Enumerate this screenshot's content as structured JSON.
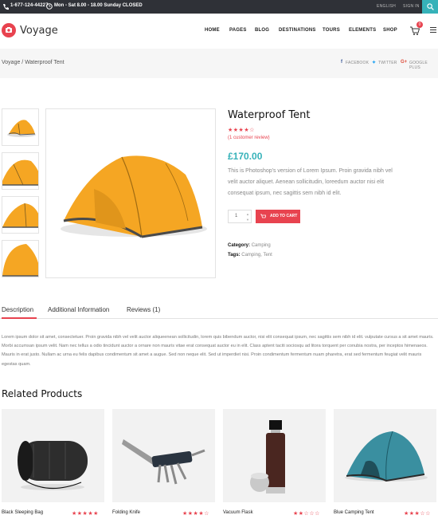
{
  "topbar": {
    "phone": "1-677-124-44227",
    "hours": "Mon - Sat 8.00 - 18.00 Sunday CLOSED",
    "language": "ENGLISH",
    "signin": "SIGN IN",
    "search_icon": "search-icon"
  },
  "header": {
    "logo_text": "Voyage",
    "nav": [
      "HOME",
      "PAGES",
      "BLOG",
      "DESTINATIONS",
      "TOURS",
      "ELEMENTS",
      "SHOP"
    ],
    "cart_count": "0"
  },
  "breadcrumb": {
    "text": "Voyage / Waterproof Tent",
    "share": {
      "facebook": "FACEBOOK",
      "twitter": "TWITTER",
      "google": "GOOGLE PLUS"
    }
  },
  "product": {
    "title": "Waterproof Tent",
    "stars": "★★★★☆",
    "rating": 4,
    "review_link": "(1 customer review)",
    "price": "£170.00",
    "description": "This is Photoshop's version of Lorem Ipsum. Proin gravida nibh vel velit auctor aliquet. Aenean sollicitudin, loreedum auctor nisi elit consequat ipsum, nec sagittis sem nibh id elit.",
    "quantity": "1",
    "add_to_cart": "ADD TO CART",
    "category_label": "Category:",
    "category_value": "Camping",
    "tags_label": "Tags:",
    "tags_value": "Camping, Tent"
  },
  "tabs": [
    "Description",
    "Additional Information",
    "Reviews (1)"
  ],
  "long_description": "Lorem ipsum dolor sit amet, consectetuer. Proin gravida nibh vel velit auctor aliqueenean sollicitudin, lorem quis bibendum auctor, nisi elit consequat ipsum, nec sagittis sem nibh id elit. vulputate cursus a sit amet mauris. Morbi accumsan ipsum velit. Nam nec tellus a odio tincidunt auctor a ornare non mauris vitae erat consequat auctor eu in elit. Class aptent taciti sociosqu ad litora torquent per conubia nostra, per inceptos himenaeos. Mauris in erat justo. Nullam ac urna eu felis dapibus condimentum sit amet a augue. Sed non neque elit. Sed ut imperdiet nisi. Proin condimentum fermentum nuam pharetra, erat sed fermentum feugiat velit mauris egestas quam.",
  "related": {
    "title": "Related Products",
    "items": [
      {
        "name": "Black Sleeping Bag",
        "stars": "★★★★★",
        "rating": 5
      },
      {
        "name": "Folding Knife",
        "stars": "★★★★☆",
        "rating": 4
      },
      {
        "name": "Vacuum Flask",
        "stars": "★★☆☆☆",
        "rating": 2
      },
      {
        "name": "Blue Camping Tent",
        "stars": "★★★☆☆",
        "rating": 3
      }
    ]
  },
  "colors": {
    "accent_red": "#e8434f",
    "accent_teal": "#36b2b9",
    "topbar": "#2f3137",
    "tent_orange": "#f5a623"
  }
}
